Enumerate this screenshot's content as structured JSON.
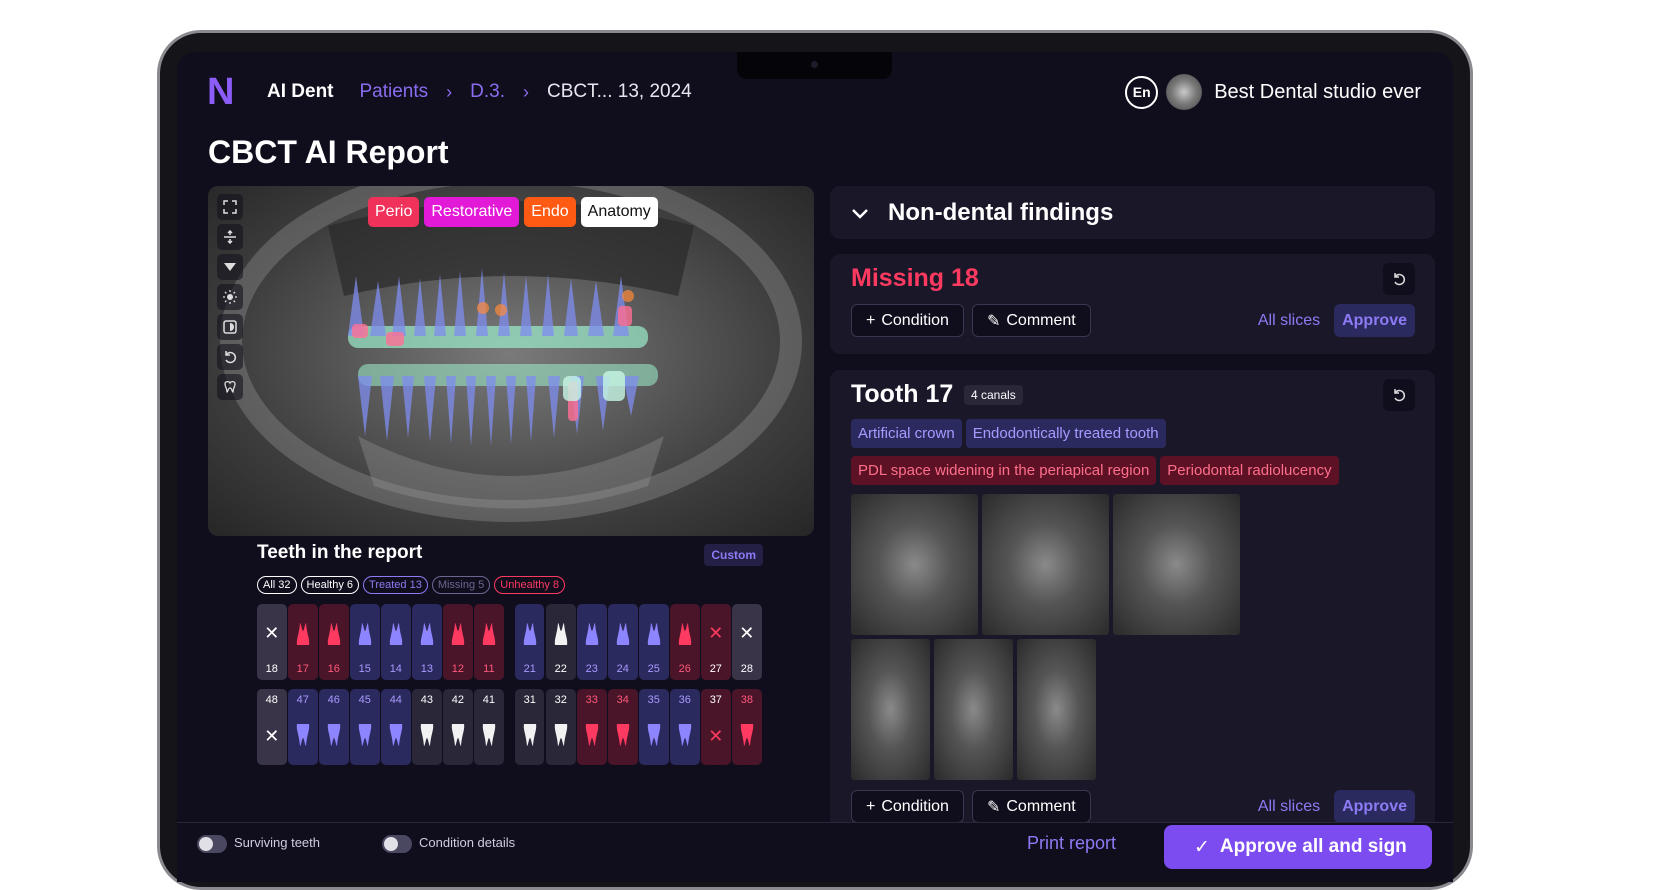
{
  "app": {
    "logo": "N",
    "name": "AI Dent"
  },
  "breadcrumb": {
    "patients": "Patients",
    "patient": "D.3.",
    "current": "CBCT... 13, 2024",
    "sep": "›"
  },
  "header": {
    "lang": "En",
    "studio": "Best Dental studio ever"
  },
  "page": {
    "title": "CBCT AI Report"
  },
  "viewer": {
    "tools": [
      "expand-icon",
      "split-icon",
      "filter-icon",
      "brightness-icon",
      "contrast-icon",
      "undo-icon",
      "tooth-view-icon"
    ],
    "chips": [
      {
        "label": "Perio",
        "color": "#f0325a"
      },
      {
        "label": "Restorative",
        "color": "#e21ad8"
      },
      {
        "label": "Endo",
        "color": "#ff5a14"
      },
      {
        "label": "Anatomy",
        "color": "#ffffff"
      }
    ]
  },
  "teeth_panel": {
    "title": "Teeth in the report",
    "custom": "Custom",
    "filters": [
      {
        "label": "All 32",
        "color": "#ffffff"
      },
      {
        "label": "Healthy 6",
        "color": "#ffffff"
      },
      {
        "label": "Treated 13",
        "color": "#8d7bf5"
      },
      {
        "label": "Missing 5",
        "color": "#6b6690"
      },
      {
        "label": "Unhealthy 8",
        "color": "#ff3a61"
      }
    ],
    "upper": [
      {
        "n": "18",
        "s": "missing"
      },
      {
        "n": "17",
        "s": "unhealthy"
      },
      {
        "n": "16",
        "s": "unhealthy"
      },
      {
        "n": "15",
        "s": "treated"
      },
      {
        "n": "14",
        "s": "treated"
      },
      {
        "n": "13",
        "s": "treated"
      },
      {
        "n": "12",
        "s": "unhealthy"
      },
      {
        "n": "11",
        "s": "unhealthy"
      },
      {
        "n": "21",
        "s": "treated"
      },
      {
        "n": "22",
        "s": "healthy"
      },
      {
        "n": "23",
        "s": "treated"
      },
      {
        "n": "24",
        "s": "treated"
      },
      {
        "n": "25",
        "s": "treated"
      },
      {
        "n": "26",
        "s": "unhealthy"
      },
      {
        "n": "27",
        "s": "missing-x"
      },
      {
        "n": "28",
        "s": "missing"
      }
    ],
    "lower": [
      {
        "n": "48",
        "s": "missing"
      },
      {
        "n": "47",
        "s": "treated"
      },
      {
        "n": "46",
        "s": "treated"
      },
      {
        "n": "45",
        "s": "treated"
      },
      {
        "n": "44",
        "s": "treated"
      },
      {
        "n": "43",
        "s": "healthy"
      },
      {
        "n": "42",
        "s": "healthy"
      },
      {
        "n": "41",
        "s": "healthy"
      },
      {
        "n": "31",
        "s": "healthy"
      },
      {
        "n": "32",
        "s": "healthy"
      },
      {
        "n": "33",
        "s": "unhealthy"
      },
      {
        "n": "34",
        "s": "unhealthy"
      },
      {
        "n": "35",
        "s": "treated"
      },
      {
        "n": "36",
        "s": "treated"
      },
      {
        "n": "37",
        "s": "missing-x"
      },
      {
        "n": "38",
        "s": "unhealthy"
      }
    ]
  },
  "non_dental": {
    "title": "Non-dental findings"
  },
  "missing_card": {
    "title": "Missing 18"
  },
  "tooth_card": {
    "title": "Tooth 17",
    "canals": "4 canals",
    "tags_blue": [
      "Artificial crown",
      "Endodontically treated tooth"
    ],
    "tags_red": [
      "PDL space widening in the periapical region",
      "Periodontal radiolucency"
    ]
  },
  "actions": {
    "condition": "Condition",
    "comment": "Comment",
    "all_slices": "All slices",
    "approve": "Approve"
  },
  "bottombar": {
    "toggle1": "Surviving teeth",
    "toggle2": "Condition details",
    "print": "Print report",
    "sign": "Approve all and sign"
  }
}
